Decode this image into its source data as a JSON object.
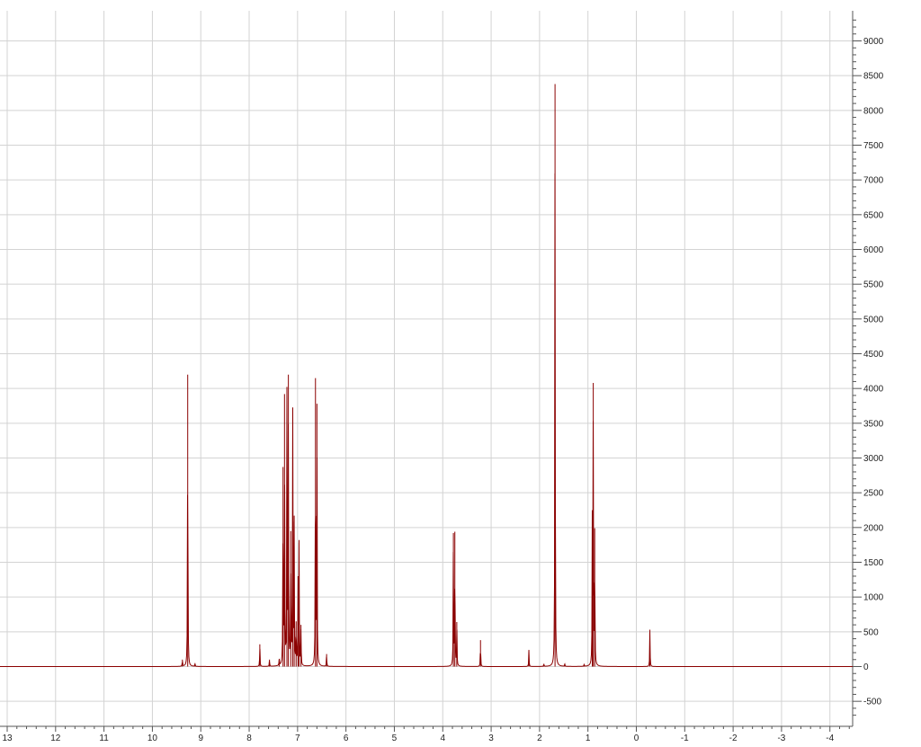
{
  "colors": {
    "spectrum": "#8b0000",
    "grid": "#d3d3d3",
    "axis": "#555555",
    "background": "#ffffff"
  },
  "chart_data": {
    "type": "line",
    "title": "",
    "xlabel": "",
    "ylabel": "",
    "x_reversed": true,
    "xlim": [
      13.1,
      -4.5
    ],
    "ylim": [
      -750,
      9300
    ],
    "grid": true,
    "x_ticks": [
      13,
      12,
      11,
      10,
      9,
      8,
      7,
      6,
      5,
      4,
      3,
      2,
      1,
      0,
      -1,
      -2,
      -3,
      -4
    ],
    "y_ticks": [
      -500,
      0,
      500,
      1000,
      1500,
      2000,
      2500,
      3000,
      3500,
      4000,
      4500,
      5000,
      5500,
      6000,
      6500,
      7000,
      7500,
      8000,
      8500,
      9000
    ],
    "y_axis_position": "right",
    "series": [
      {
        "peaks": [
          {
            "x": 9.38,
            "y": 100
          },
          {
            "x": 9.27,
            "y": 4200
          },
          {
            "x": 9.12,
            "y": 50
          },
          {
            "x": 7.78,
            "y": 320
          },
          {
            "x": 7.58,
            "y": 100
          },
          {
            "x": 7.38,
            "y": 100
          },
          {
            "x": 7.3,
            "y": 2870
          },
          {
            "x": 7.27,
            "y": 3920
          },
          {
            "x": 7.22,
            "y": 3880
          },
          {
            "x": 7.19,
            "y": 4200
          },
          {
            "x": 7.14,
            "y": 1950
          },
          {
            "x": 7.1,
            "y": 3700
          },
          {
            "x": 7.07,
            "y": 2170
          },
          {
            "x": 7.03,
            "y": 650
          },
          {
            "x": 6.99,
            "y": 1300
          },
          {
            "x": 6.97,
            "y": 1780
          },
          {
            "x": 6.93,
            "y": 600
          },
          {
            "x": 6.63,
            "y": 4150
          },
          {
            "x": 6.6,
            "y": 3780
          },
          {
            "x": 6.4,
            "y": 180
          },
          {
            "x": 3.78,
            "y": 1920
          },
          {
            "x": 3.75,
            "y": 1940
          },
          {
            "x": 3.71,
            "y": 640
          },
          {
            "x": 3.22,
            "y": 380
          },
          {
            "x": 2.22,
            "y": 240
          },
          {
            "x": 1.91,
            "y": 40
          },
          {
            "x": 1.68,
            "y": 8380
          },
          {
            "x": 1.48,
            "y": 40
          },
          {
            "x": 1.08,
            "y": 30
          },
          {
            "x": 0.91,
            "y": 2090
          },
          {
            "x": 0.89,
            "y": 4080
          },
          {
            "x": 0.86,
            "y": 1990
          },
          {
            "x": -0.28,
            "y": 530
          }
        ]
      }
    ]
  }
}
